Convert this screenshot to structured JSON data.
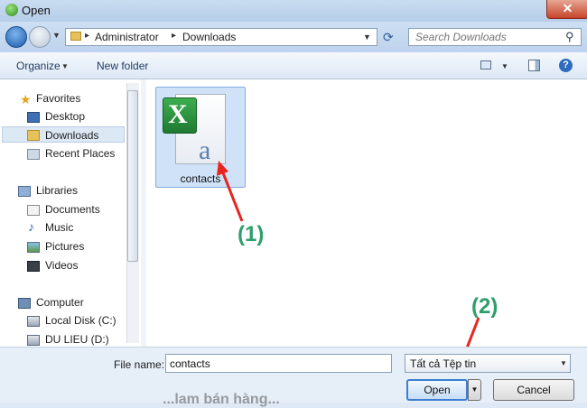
{
  "window": {
    "title": "Open",
    "close_label": "✕"
  },
  "address_bar": {
    "breadcrumbs": [
      "Administrator",
      "Downloads"
    ],
    "separator": "▸",
    "search_placeholder": "Search Downloads"
  },
  "toolbar": {
    "organize_label": "Organize",
    "new_folder_label": "New folder",
    "help_label": "?"
  },
  "nav": {
    "favorites": {
      "label": "Favorites",
      "items": [
        "Desktop",
        "Downloads",
        "Recent Places"
      ]
    },
    "libraries": {
      "label": "Libraries",
      "items": [
        "Documents",
        "Music",
        "Pictures",
        "Videos"
      ]
    },
    "computer": {
      "label": "Computer",
      "items": [
        "Local Disk (C:)",
        "DU LIEU (D:)"
      ]
    },
    "selected": "Downloads"
  },
  "files": [
    {
      "name": "contacts",
      "type_icon": "excel-csv-icon"
    }
  ],
  "annotations": {
    "step1": "(1)",
    "step2": "(2)",
    "color": "#2e9e6c",
    "arrow_color": "#e8251f"
  },
  "bottom": {
    "file_name_label": "File name:",
    "file_name_value": "contacts",
    "file_type": "Tất cả Tệp tin",
    "open_label": "Open",
    "cancel_label": "Cancel"
  },
  "watermark": "...lam bán hàng..."
}
